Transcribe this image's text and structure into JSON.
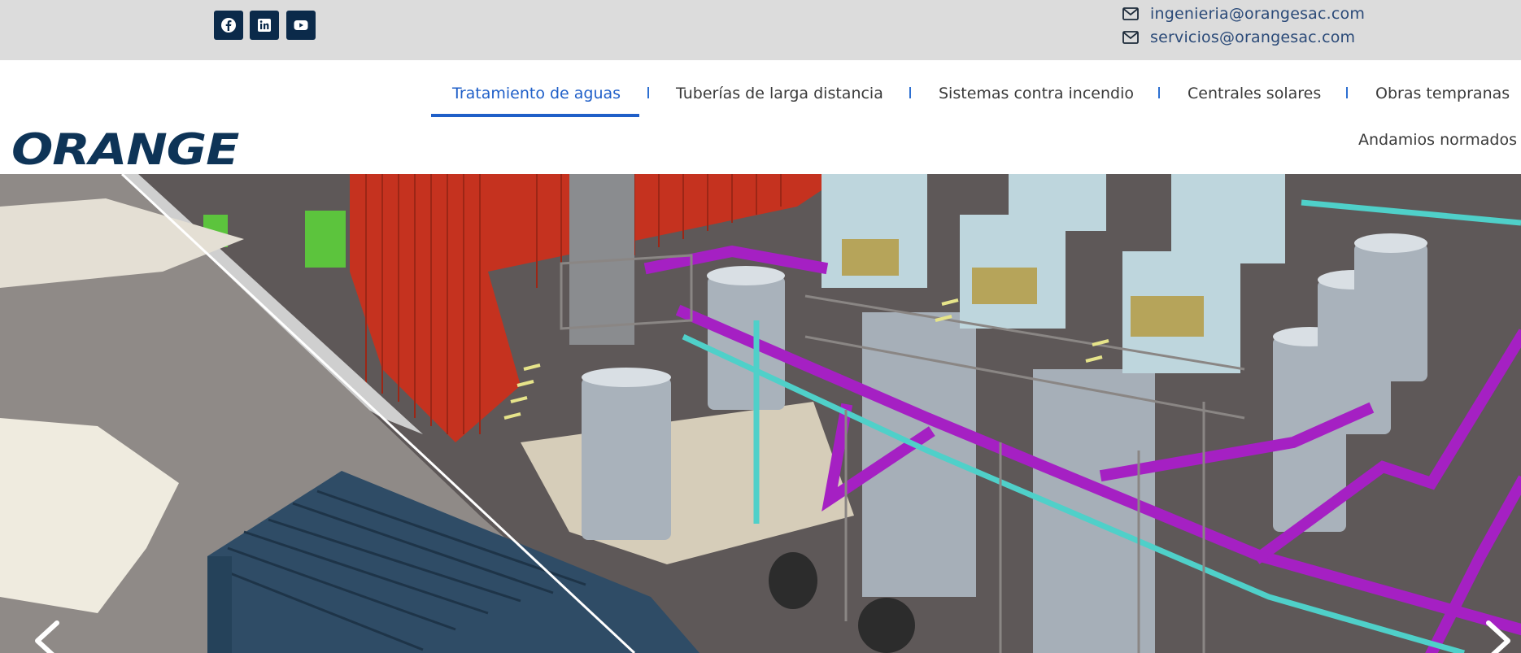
{
  "topbar": {
    "social": [
      {
        "name": "facebook-icon",
        "label": "Facebook"
      },
      {
        "name": "linkedin-icon",
        "label": "LinkedIn"
      },
      {
        "name": "youtube-icon",
        "label": "YouTube"
      }
    ],
    "emails": [
      "ingenieria@orangesac.com",
      "servicios@orangesac.com"
    ],
    "icon_color": "#0b2a4a",
    "text_color": "#2b4a78"
  },
  "header": {
    "logo": "ORANGE",
    "logo_color": "#0e3457",
    "nav": [
      {
        "label": "Tratamiento de aguas",
        "active": true
      },
      {
        "label": "Tuberías de larga distancia",
        "active": false
      },
      {
        "label": "Sistemas contra incendio",
        "active": false
      },
      {
        "label": "Centrales solares",
        "active": false
      },
      {
        "label": "Obras tempranas",
        "active": false
      },
      {
        "label": "Andamios normados",
        "active": false
      }
    ],
    "active_color": "#1f5fc8"
  },
  "hero": {
    "prev_icon": "chevron-left-icon",
    "next_icon": "chevron-right-icon"
  }
}
